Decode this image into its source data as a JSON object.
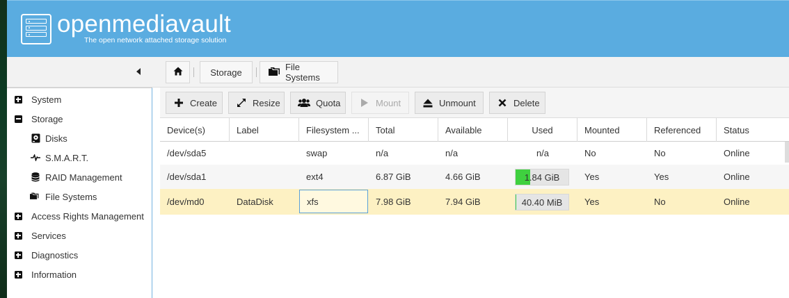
{
  "header": {
    "title": "openmediavault",
    "subtitle": "The open network attached storage solution",
    "bg_color": "#5aace0"
  },
  "breadcrumb": {
    "home_icon": "home-icon",
    "items": [
      {
        "label": "Storage"
      },
      {
        "label": "File Systems",
        "icon": "folders-icon"
      }
    ]
  },
  "sidebar": {
    "collapse_icon": "caret-left-icon",
    "items": [
      {
        "label": "System",
        "icon": "plus-square-icon",
        "level": 0
      },
      {
        "label": "Storage",
        "icon": "minus-square-icon",
        "level": 0
      },
      {
        "label": "Disks",
        "icon": "disk-icon",
        "level": 1
      },
      {
        "label": "S.M.A.R.T.",
        "icon": "pulse-icon",
        "level": 1
      },
      {
        "label": "RAID Management",
        "icon": "database-icon",
        "level": 1
      },
      {
        "label": "File Systems",
        "icon": "folders-icon",
        "level": 1
      },
      {
        "label": "Access Rights Management",
        "icon": "plus-square-icon",
        "level": 0
      },
      {
        "label": "Services",
        "icon": "plus-square-icon",
        "level": 0
      },
      {
        "label": "Diagnostics",
        "icon": "plus-square-icon",
        "level": 0
      },
      {
        "label": "Information",
        "icon": "plus-square-icon",
        "level": 0
      }
    ]
  },
  "toolbar": {
    "buttons": [
      {
        "label": "Create",
        "icon": "plus-icon",
        "enabled": true
      },
      {
        "label": "Resize",
        "icon": "expand-arrows-icon",
        "enabled": true
      },
      {
        "label": "Quota",
        "icon": "users-icon",
        "enabled": true
      },
      {
        "label": "Mount",
        "icon": "play-icon",
        "enabled": false
      },
      {
        "label": "Unmount",
        "icon": "eject-icon",
        "enabled": true
      },
      {
        "label": "Delete",
        "icon": "close-icon",
        "enabled": true
      }
    ]
  },
  "table": {
    "columns": [
      "Device(s)",
      "Label",
      "Filesystem ...",
      "Total",
      "Available",
      "Used",
      "Mounted",
      "Referenced",
      "Status"
    ],
    "rows": [
      {
        "device": "/dev/sda5",
        "label": "",
        "filesystem": "swap",
        "total": "n/a",
        "available": "n/a",
        "used": "n/a",
        "used_fraction": null,
        "mounted": "No",
        "referenced": "No",
        "status": "Online"
      },
      {
        "device": "/dev/sda1",
        "label": "",
        "filesystem": "ext4",
        "total": "6.87 GiB",
        "available": "4.66 GiB",
        "used": "1.84 GiB",
        "used_fraction": 0.27,
        "mounted": "Yes",
        "referenced": "Yes",
        "status": "Online"
      },
      {
        "device": "/dev/md0",
        "label": "DataDisk",
        "filesystem": "xfs",
        "total": "7.98 GiB",
        "available": "7.94 GiB",
        "used": "40.40 MiB",
        "used_fraction": 0.005,
        "mounted": "Yes",
        "referenced": "No",
        "status": "Online"
      }
    ],
    "selected_row": 2,
    "row_colors": {
      "alt": "#f5f5f5",
      "selected": "#fdf1c3",
      "used_fill": "#3fd03f"
    }
  }
}
